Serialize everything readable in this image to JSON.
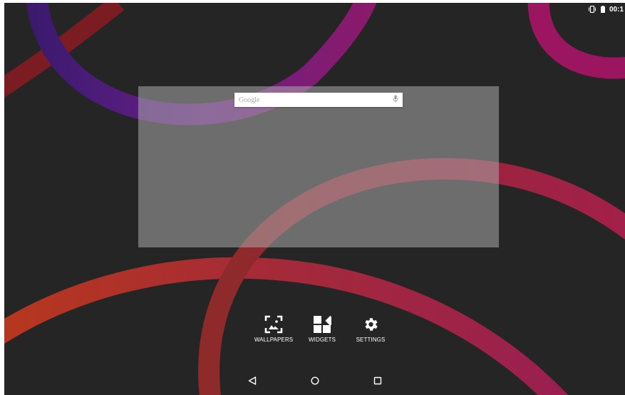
{
  "status_bar": {
    "vibrate_icon": "vibrate-icon",
    "battery_icon": "battery-icon",
    "time": "00:1"
  },
  "search": {
    "placeholder": "Google",
    "mic_icon": "mic-icon"
  },
  "home_options": [
    {
      "label": "WALLPAPERS",
      "icon": "wallpaper-icon"
    },
    {
      "label": "WIDGETS",
      "icon": "widgets-icon"
    },
    {
      "label": "SETTINGS",
      "icon": "settings-gear-icon"
    }
  ],
  "nav": {
    "back_icon": "back-icon",
    "home_icon": "home-icon",
    "recents_icon": "recents-icon"
  },
  "colors": {
    "background": "#252525",
    "arc_purple": "#6b1f8c",
    "arc_magenta": "#a0155a",
    "arc_red": "#a3263a",
    "arc_orange": "#c33a1a"
  }
}
